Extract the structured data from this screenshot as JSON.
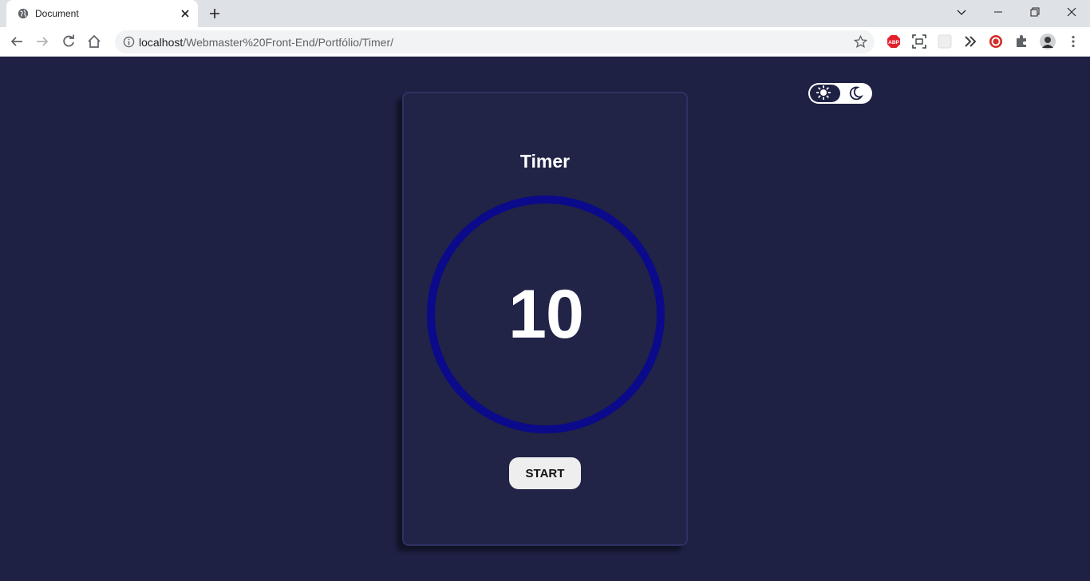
{
  "browser": {
    "tab_title": "Document",
    "url_host": "localhost",
    "url_path": "/Webmaster%20Front-End/Portfólio/Timer/",
    "icons": [
      "globe-icon",
      "close-icon",
      "plus-icon",
      "chevron-down-icon",
      "minimize-icon",
      "restore-icon",
      "close-window-icon",
      "back-icon",
      "forward-icon",
      "reload-icon",
      "home-icon",
      "info-icon",
      "star-icon",
      "adblock-icon",
      "screenshot-icon",
      "extension-icon",
      "menu-icon"
    ]
  },
  "theme_toggle": {
    "icons": [
      "sun-icon",
      "moon-icon"
    ],
    "active": "dark"
  },
  "timer": {
    "title": "Timer",
    "count": "10",
    "start_label": "START"
  },
  "colors": {
    "page_bg": "#1e2144",
    "card_bg": "#212347",
    "ring": "#0a0a8a",
    "button_bg": "#eeeeee"
  }
}
